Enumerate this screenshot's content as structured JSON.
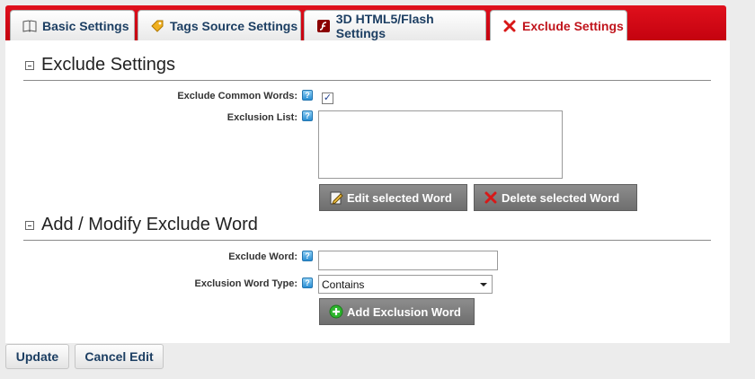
{
  "tabs": [
    {
      "label": "Basic Settings",
      "icon": "book-icon"
    },
    {
      "label": "Tags Source Settings",
      "icon": "tag-icon"
    },
    {
      "label": "3D HTML5/Flash Settings",
      "icon": "flash-icon"
    },
    {
      "label": "Exclude Settings",
      "icon": "red-x-icon"
    }
  ],
  "exclude_settings": {
    "title": "Exclude Settings",
    "common_words_label": "Exclude Common Words:",
    "common_words_checked": true,
    "exclusion_list_label": "Exclusion List:",
    "edit_button": "Edit selected Word",
    "delete_button": "Delete selected Word"
  },
  "add_modify": {
    "title": "Add / Modify Exclude Word",
    "word_label": "Exclude Word:",
    "word_value": "",
    "type_label": "Exclusion Word Type:",
    "type_value": "Contains",
    "add_button": "Add Exclusion Word"
  },
  "footer": {
    "update": "Update",
    "cancel": "Cancel Edit"
  },
  "colors": {
    "tab_bar": "#d0021b",
    "active_tab_text": "#c0141c",
    "tab_text": "#1d3f63",
    "gray_button": "#7d7d7d"
  }
}
